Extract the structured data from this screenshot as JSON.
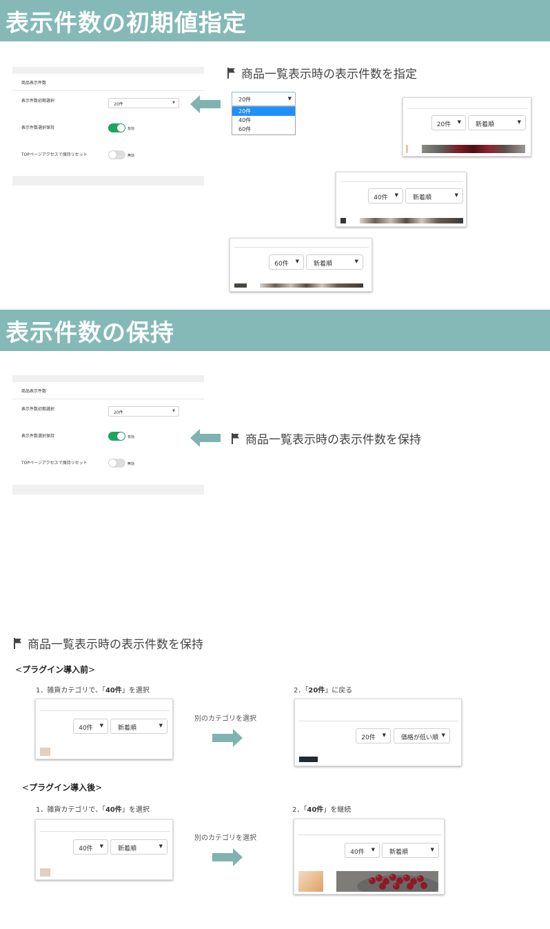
{
  "section1": {
    "banner": "表示件数の初期値指定",
    "heading": "商品一覧表示時の表示件数を指定",
    "admin": {
      "title": "商品表示件数",
      "row_initial": "表示件数初期選択",
      "initial_value": "20件",
      "row_keep": "表示件数選択保持",
      "keep_state": "有効",
      "row_reset": "TOPページアクセスで保持リセット",
      "reset_state": "無効"
    },
    "dropdown": {
      "selected": "20件",
      "options": [
        "20件",
        "40件",
        "60件"
      ]
    },
    "cards": [
      {
        "count": "20件",
        "sort": "新着順"
      },
      {
        "count": "40件",
        "sort": "新着順"
      },
      {
        "count": "60件",
        "sort": "新着順"
      }
    ]
  },
  "section2": {
    "banner": "表示件数の保持",
    "heading": "商品一覧表示時の表示件数を保持",
    "admin": {
      "title": "商品表示件数",
      "row_initial": "表示件数初期選択",
      "initial_value": "20件",
      "row_keep": "表示件数選択保持",
      "keep_state": "有効",
      "row_reset": "TOPページアクセスで保持リセット",
      "reset_state": "無効"
    }
  },
  "section3": {
    "heading": "商品一覧表示時の表示件数を保持",
    "before": {
      "open": "<",
      "label": "プラグイン導入前",
      "close": ">",
      "step1_prefix": "1．雑貨カテゴリで、「",
      "step1_value": "40件",
      "step1_suffix": "」を選択",
      "step2_prefix": "2．「",
      "step2_value": "20件",
      "step2_suffix": "」に戻る",
      "transition": "別のカテゴリを選択",
      "card1": {
        "count": "40件",
        "sort": "新着順"
      },
      "card2": {
        "count": "20件",
        "sort": "価格が低い順"
      }
    },
    "after": {
      "open": "<",
      "label": "プラグイン導入後",
      "close": ">",
      "step1_prefix": "1．雑貨カテゴリで、「",
      "step1_value": "40件",
      "step1_suffix": "」を選択",
      "step2_prefix": "2．「",
      "step2_value": "40件",
      "step2_suffix": "」を継続",
      "transition": "別のカテゴリを選択",
      "card1": {
        "count": "40件",
        "sort": "新着順"
      },
      "card2": {
        "count": "40件",
        "sort": "新着順"
      }
    }
  },
  "colors": {
    "banner": "#84b9b7",
    "arrow": "#7fb2b0",
    "toggle_on": "#1ea362",
    "dropdown_highlight": "#1e90ff"
  }
}
